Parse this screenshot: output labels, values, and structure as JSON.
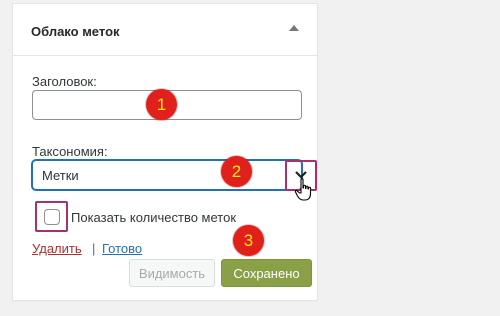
{
  "widget": {
    "title": "Облако меток",
    "title_field": {
      "label": "Заголовок:",
      "value": ""
    },
    "taxonomy": {
      "label": "Таксономия:",
      "selected": "Метки"
    },
    "show_count": {
      "label": "Показать количество меток",
      "checked": false
    },
    "links": {
      "delete": "Удалить",
      "separator": "|",
      "done": "Готово"
    },
    "buttons": {
      "visibility": "Видимость",
      "saved": "Сохранено"
    }
  },
  "markers": [
    "1",
    "2",
    "3"
  ],
  "colors": {
    "marker_bg": "#e0201b",
    "marker_text": "#ffe81a",
    "highlight_border": "#a3336a",
    "saved_button": "#8aa046",
    "focus_border": "#2271b1",
    "delete_link": "#b32d2e"
  },
  "icons": [
    "collapse-arrow-icon",
    "chevron-down-icon",
    "hand-cursor-icon"
  ]
}
